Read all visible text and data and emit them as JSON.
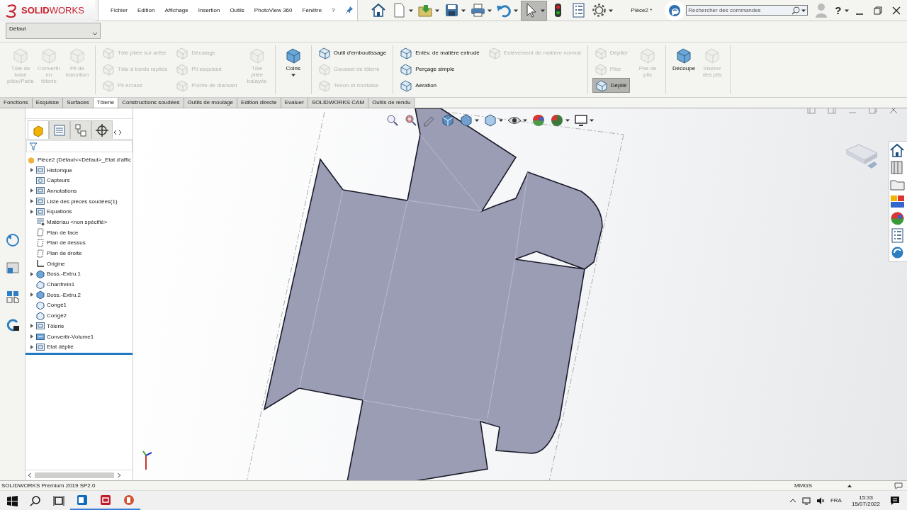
{
  "logo": "**SOLID**WORKS",
  "menu": [
    "Fichier",
    "Edition",
    "Affichage",
    "Insertion",
    "Outils",
    "PhotoView 360",
    "Fenêtre",
    "?"
  ],
  "document_title": "Pièce2 *",
  "search": {
    "placeholder": "Rechercher des commandes"
  },
  "help_label": "?",
  "configuration": {
    "value": "Défaut"
  },
  "ribbon": {
    "sections": [
      {
        "columns": [
          {
            "kind": "large",
            "items": [
              {
                "label": "Tôle de base pliée/Patte",
                "disabled": true
              },
              {
                "label": "Convertir en tôlerie",
                "disabled": true
              },
              {
                "label": "Pli de transition",
                "disabled": true
              }
            ]
          }
        ]
      },
      {
        "columns": [
          {
            "kind": "stack",
            "items": [
              {
                "label": "Tôle pliée sur arête",
                "disabled": true
              },
              {
                "label": "Tôle à bords repliés",
                "disabled": true
              },
              {
                "label": "Pli écrasé",
                "disabled": true
              }
            ]
          },
          {
            "kind": "stack",
            "items": [
              {
                "label": "Décalage",
                "disabled": true
              },
              {
                "label": "Pli esquissé",
                "disabled": true
              },
              {
                "label": "Pointe de diamant",
                "disabled": true
              }
            ]
          },
          {
            "kind": "large",
            "items": [
              {
                "label": "Tôle pliée balayée",
                "disabled": true
              }
            ]
          }
        ]
      },
      {
        "columns": [
          {
            "kind": "large",
            "items": [
              {
                "label": "Coins",
                "disabled": false,
                "menu": true
              }
            ]
          }
        ]
      },
      {
        "columns": [
          {
            "kind": "stack",
            "items": [
              {
                "label": "Outil d'emboutissage",
                "disabled": false
              },
              {
                "label": "Gousset de tôlerie",
                "disabled": true
              },
              {
                "label": "Tenon et mortaise",
                "disabled": true
              }
            ]
          }
        ]
      },
      {
        "columns": [
          {
            "kind": "stack",
            "items": [
              {
                "label": "Enlèv. de matière extrudé",
                "disabled": false
              },
              {
                "label": "Perçage simple",
                "disabled": false
              },
              {
                "label": "Aération",
                "disabled": false
              }
            ]
          },
          {
            "kind": "stack",
            "items": [
              {
                "label": "Enlèvement de matière normal",
                "disabled": true
              }
            ]
          }
        ]
      },
      {
        "columns": [
          {
            "kind": "stack",
            "items": [
              {
                "label": "Déplier",
                "disabled": true,
                "pressed": false
              },
              {
                "label": "Plier",
                "disabled": true,
                "pressed": false
              },
              {
                "label": "Déplié",
                "disabled": false,
                "pressed": true
              }
            ]
          },
          {
            "kind": "large",
            "items": [
              {
                "label": "Pas de plis",
                "disabled": true
              }
            ]
          }
        ]
      },
      {
        "columns": [
          {
            "kind": "large",
            "items": [
              {
                "label": "Découpe",
                "disabled": false
              },
              {
                "label": "Insérer des plis",
                "disabled": true
              }
            ]
          }
        ]
      }
    ]
  },
  "tabs": [
    {
      "label": "Fonctions",
      "selected": false
    },
    {
      "label": "Esquisse",
      "selected": false
    },
    {
      "label": "Surfaces",
      "selected": false
    },
    {
      "label": "Tôlerie",
      "selected": true
    },
    {
      "label": "Constructions soudées",
      "selected": false
    },
    {
      "label": "Outils de moulage",
      "selected": false
    },
    {
      "label": "Edition directe",
      "selected": false
    },
    {
      "label": "Evaluer",
      "selected": false
    },
    {
      "label": "SOLIDWORKS CAM",
      "selected": false
    },
    {
      "label": "Outils de rendu",
      "selected": false
    }
  ],
  "panel_tabs": [
    {
      "kind": "features",
      "selected": true
    },
    {
      "kind": "properties",
      "selected": false
    },
    {
      "kind": "configurations",
      "selected": false
    },
    {
      "kind": "dimxpert",
      "selected": false
    }
  ],
  "feature_tree": {
    "root": {
      "label": "Pièce2  (Défaut<<Défaut>_Etat d'affic",
      "children": [
        {
          "label": "Historique",
          "kind": "folder",
          "expandable": true
        },
        {
          "label": "Capteurs",
          "kind": "sensor",
          "expandable": false
        },
        {
          "label": "Annotations",
          "kind": "folder",
          "expandable": true
        },
        {
          "label": "Liste des pièces soudées(1)",
          "kind": "folder",
          "expandable": true
        },
        {
          "label": "Equations",
          "kind": "folder",
          "expandable": true
        },
        {
          "label": "Matériau <non spécifié>",
          "kind": "material",
          "expandable": false
        },
        {
          "label": "Plan de face",
          "kind": "plane",
          "expandable": false
        },
        {
          "label": "Plan de dessus",
          "kind": "plane",
          "expandable": false
        },
        {
          "label": "Plan de droite",
          "kind": "plane",
          "expandable": false
        },
        {
          "label": "Origine",
          "kind": "origin",
          "expandable": false
        },
        {
          "label": "Boss.-Extru.1",
          "kind": "solid",
          "expandable": true
        },
        {
          "label": "Chanfrein1",
          "kind": "chamfer",
          "expandable": false
        },
        {
          "label": "Boss.-Extru.2",
          "kind": "solid",
          "expandable": true
        },
        {
          "label": "Congé1",
          "kind": "fillet",
          "expandable": false
        },
        {
          "label": "Congé2",
          "kind": "fillet",
          "expandable": false
        },
        {
          "label": "Tôlerie",
          "kind": "folder",
          "expandable": true
        },
        {
          "label": "Convertir-Volume1",
          "kind": "convert",
          "expandable": true
        },
        {
          "label": "Etat déplié",
          "kind": "folder",
          "expandable": true
        }
      ]
    }
  },
  "status_bar": {
    "product": "SOLIDWORKS Premium 2019 SP2.0",
    "units": "MMGS"
  },
  "taskbar": {
    "language": "FRA",
    "time": "15:33",
    "date": "15/07/2022"
  }
}
